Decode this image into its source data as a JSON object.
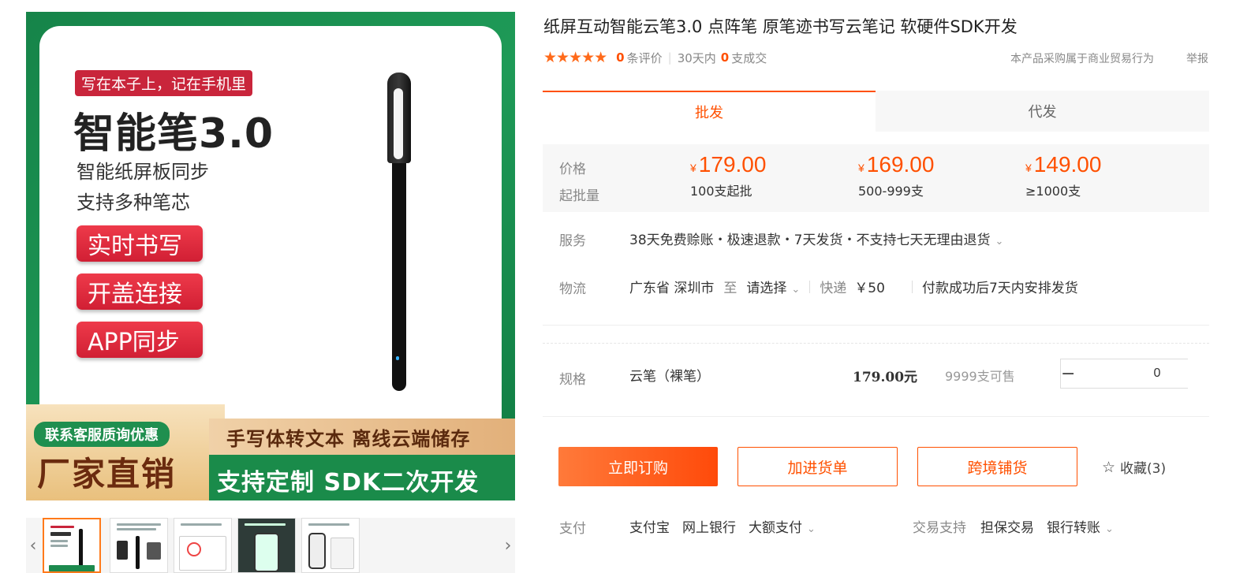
{
  "product_image": {
    "tagline": "写在本子上，记在手机里",
    "headline": "智能笔3.0",
    "sub_lines": [
      "智能纸屏板同步",
      "支持多种笔芯"
    ],
    "feature_buttons": [
      "实时书写",
      "开盖连接",
      "APP同步"
    ],
    "contact_pill": "联系客服质询优惠",
    "factory_text": "厂家直销",
    "strip_text_1": "手写体转文本  离线云端储存",
    "strip_text_2": "支持定制 SDK二次开发"
  },
  "thumbnails": {
    "prev_icon": "‹",
    "next_icon": "›",
    "count": 5
  },
  "title": "纸屏互动智能云笔3.0 点阵笔 原笔迹书写云笔记 软硬件SDK开发",
  "rating": {
    "stars": "★★★★★",
    "review_count": "0",
    "review_label": "条评价",
    "period_label": "30天内",
    "sold_count": "0",
    "sold_label": "支成交"
  },
  "report_note": "本产品采购属于商业贸易行为",
  "report_link": "举报",
  "tabs": [
    "批发",
    "代发"
  ],
  "price": {
    "price_label": "价格",
    "moq_label": "起批量",
    "currency": "¥",
    "tiers": [
      {
        "price": "179.00",
        "qty": "100支起批"
      },
      {
        "price": "169.00",
        "qty": "500-999支"
      },
      {
        "price": "149.00",
        "qty": "≥1000支"
      }
    ]
  },
  "service": {
    "label": "服务",
    "text": "38天免费赊账・极速退款・7天发货・不支持七天无理由退货"
  },
  "logistics": {
    "label": "物流",
    "origin": "广东省 深圳市",
    "to": "至",
    "destination": "请选择",
    "method": "快递",
    "fee": "￥50",
    "note": "付款成功后7天内安排发货"
  },
  "spec": {
    "label": "规格",
    "name": "云笔（裸笔）",
    "price": "179.00元",
    "stock": "9999支可售",
    "quantity": "0",
    "minus": "−",
    "plus": "+"
  },
  "actions": {
    "buy": "立即订购",
    "add_cart": "加进货单",
    "cross_border": "跨境铺货",
    "favorite": "收藏(3)"
  },
  "payment": {
    "label": "支付",
    "methods": [
      "支付宝",
      "网上银行",
      "大额支付"
    ],
    "trade_label": "交易支持",
    "trade_methods": [
      "担保交易",
      "银行转账"
    ]
  },
  "colors": {
    "accent": "#ff5000",
    "brand_green": "#1c8a4e",
    "promo_red": "#d11f34"
  }
}
